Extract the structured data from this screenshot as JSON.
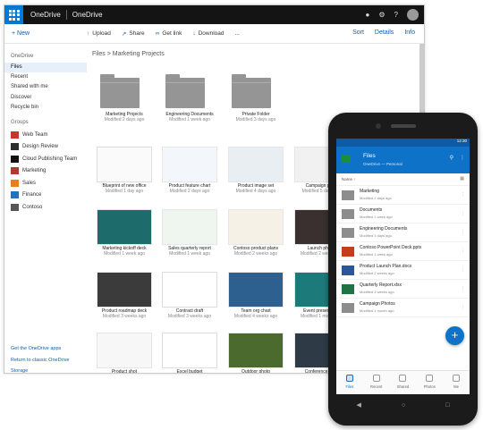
{
  "topbar": {
    "brand": "OneDrive",
    "location": "OneDrive",
    "icons": [
      "bell-icon",
      "gear-icon",
      "help-icon"
    ]
  },
  "commands": {
    "new": "+ New",
    "items": [
      {
        "icon": "upload-icon",
        "label": "Upload"
      },
      {
        "icon": "share-icon",
        "label": "Share"
      },
      {
        "icon": "link-icon",
        "label": "Get link"
      },
      {
        "icon": "download-icon",
        "label": "Download"
      }
    ],
    "more": "...",
    "right": [
      "Sort",
      "Details",
      "Info"
    ]
  },
  "sidebar": {
    "header": "OneDrive",
    "items": [
      "Files",
      "Recent",
      "Shared with me",
      "Discover",
      "Recycle bin"
    ],
    "groups_header": "Groups",
    "groups": [
      {
        "name": "Web Team",
        "color": "#c0392b"
      },
      {
        "name": "Design Review",
        "color": "#2d2d2d"
      },
      {
        "name": "Cloud Publishing Team",
        "color": "#111111"
      },
      {
        "name": "Marketing",
        "color": "#b03a2e"
      },
      {
        "name": "Sales",
        "color": "#e67e22"
      },
      {
        "name": "Finance",
        "color": "#2e6fb0"
      },
      {
        "name": "Contoso",
        "color": "#555555"
      }
    ],
    "bottom": [
      "Get the OneDrive apps",
      "Return to classic OneDrive",
      "Storage"
    ]
  },
  "breadcrumb": "Files > Marketing Projects",
  "tiles": [
    {
      "title": "Marketing Projects",
      "sub": "Modified 2 days ago",
      "kind": "folder"
    },
    {
      "title": "Engineering Documents",
      "sub": "Modified 1 week ago",
      "kind": "folder"
    },
    {
      "title": "Private Folder",
      "sub": "Modified 3 days ago",
      "kind": "folder"
    },
    {
      "title": "Blueprint of new office",
      "sub": "Modified 1 day ago",
      "kind": "plan"
    },
    {
      "title": "Product feature chart",
      "sub": "Modified 2 days ago",
      "kind": "diagram"
    },
    {
      "title": "Product image set",
      "sub": "Modified 4 days ago",
      "kind": "product"
    },
    {
      "title": "Campaign photo",
      "sub": "Modified 5 days ago",
      "kind": "photo"
    },
    {
      "title": "Marketing kickoff deck",
      "sub": "Modified 1 week ago",
      "kind": "teal"
    },
    {
      "title": "Sales quarterly report",
      "sub": "Modified 1 week ago",
      "kind": "sheet"
    },
    {
      "title": "Contoso product plans",
      "sub": "Modified 2 weeks ago",
      "kind": "circle"
    },
    {
      "title": "Launch photos",
      "sub": "Modified 2 weeks ago",
      "kind": "dark"
    },
    {
      "title": "Product roadmap deck",
      "sub": "Modified 3 weeks ago",
      "kind": "darkdeck"
    },
    {
      "title": "Contract draft",
      "sub": "Modified 3 weeks ago",
      "kind": "doc"
    },
    {
      "title": "Team org chart",
      "sub": "Modified 4 weeks ago",
      "kind": "org"
    },
    {
      "title": "Event presentation",
      "sub": "Modified 1 month ago",
      "kind": "teal2"
    },
    {
      "title": "Product shot",
      "sub": "Modified 1 month ago",
      "kind": "white"
    },
    {
      "title": "Excel budget",
      "sub": "Modified 1 month ago",
      "kind": "excel"
    },
    {
      "title": "Outdoor photo",
      "sub": "Modified 1 month ago",
      "kind": "forest"
    },
    {
      "title": "Conference room",
      "sub": "Modified 2 months ago",
      "kind": "room"
    }
  ],
  "phone": {
    "status": "12:30",
    "title": "Files",
    "subtitle": "OneDrive — Personal",
    "sort": "Name ↑",
    "rows": [
      {
        "title": "Marketing",
        "sub": "Modified 2 days ago",
        "color": "#8d8d8d"
      },
      {
        "title": "Documents",
        "sub": "Modified 1 week ago",
        "color": "#8d8d8d"
      },
      {
        "title": "Engineering Documents",
        "sub": "Modified 3 days ago",
        "color": "#8d8d8d"
      },
      {
        "title": "Contoso PowerPoint Deck.pptx",
        "sub": "Modified 1 week ago",
        "color": "#c43e1c"
      },
      {
        "title": "Product Launch Plan.docx",
        "sub": "Modified 2 weeks ago",
        "color": "#2b579a"
      },
      {
        "title": "Quarterly Report.xlsx",
        "sub": "Modified 3 weeks ago",
        "color": "#217346"
      },
      {
        "title": "Campaign Photos",
        "sub": "Modified 1 month ago",
        "color": "#8d8d8d"
      }
    ],
    "tabs": [
      "Files",
      "Recent",
      "Shared",
      "Photos",
      "Me"
    ],
    "fab": "+"
  }
}
